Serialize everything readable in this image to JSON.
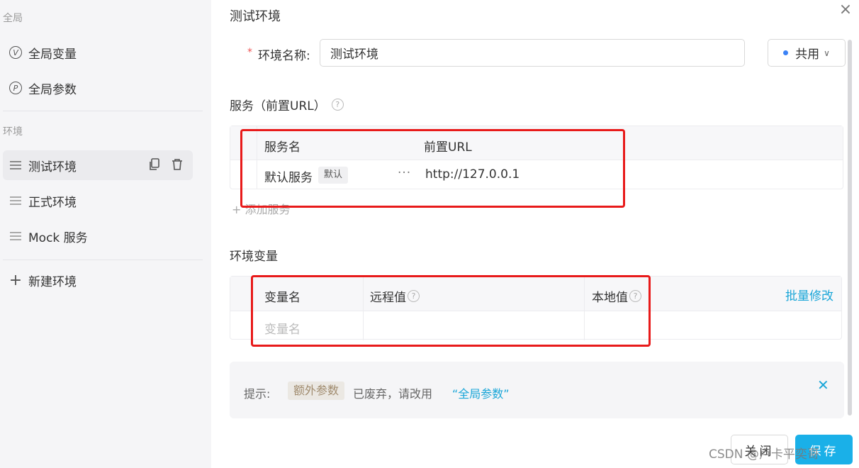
{
  "sidebar": {
    "section_global": "全局",
    "global_vars": "全局变量",
    "global_params": "全局参数",
    "section_env": "环境",
    "envs": [
      {
        "label": "测试环境"
      },
      {
        "label": "正式环境"
      },
      {
        "label": "Mock 服务"
      }
    ],
    "new_env": "新建环境"
  },
  "dialog": {
    "title": "测试环境",
    "env_name_label": "环境名称:",
    "env_name_value": "测试环境",
    "share_label": "共用",
    "services_title": "服务（前置URL）",
    "services_cols": [
      "服务名",
      "前置URL"
    ],
    "service_row": {
      "name": "默认服务",
      "tag": "默认",
      "url": "http://127.0.0.1"
    },
    "add_service": "+ 添加服务",
    "vars_title": "环境变量",
    "vars_cols": [
      "变量名",
      "远程值",
      "本地值"
    ],
    "batch_edit": "批量修改",
    "var_name_placeholder": "变量名",
    "tip_label": "提示:",
    "tip_tag": "额外参数",
    "tip_text": "已废弃，请改用",
    "tip_link": "“全局参数”",
    "close_btn": "关闭",
    "save_btn": "保存"
  },
  "watermark": "CSDN @卢卡平奕哥",
  "colors": {
    "accent": "#1ab0e8",
    "annotation": "#e81a1a",
    "share_dot": "#3b82f6"
  }
}
